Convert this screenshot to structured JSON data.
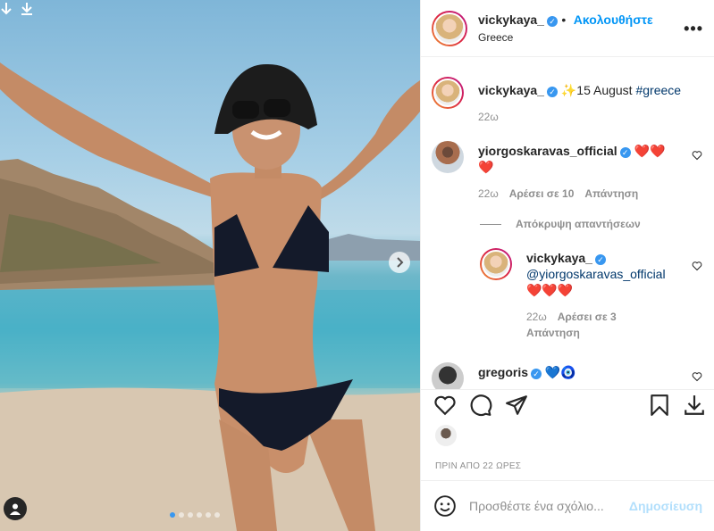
{
  "post": {
    "username": "vickykaya_",
    "follow_label": "Ακολουθήστε",
    "location": "Greece",
    "more_label": "•••"
  },
  "caption": {
    "username": "vickykaya_",
    "text_before": "✨15 August ",
    "hashtag": "#greece",
    "age": "22ω"
  },
  "comments": [
    {
      "username": "yiorgoskaravas_official",
      "text": "❤️❤️",
      "text_line2": "❤️",
      "age": "22ω",
      "likes": "Αρέσει σε 10",
      "reply": "Απάντηση"
    }
  ],
  "hide_replies": "Απόκρυψη απαντήσεων",
  "reply": {
    "username": "vickykaya_",
    "mention": "@yiorgoskaravas_official",
    "text": "❤️❤️❤️",
    "age": "22ω",
    "likes": "Αρέσει σε 3",
    "reply": "Απάντηση"
  },
  "partial_comment": {
    "username": "gregoris",
    "text": "💙🧿"
  },
  "timestamp": "ΠΡΙΝ ΑΠΟ 22 ΩΡΕΣ",
  "add_comment": {
    "placeholder": "Προσθέστε ένα σχόλιο...",
    "post_label": "Δημοσίευση"
  },
  "carousel": {
    "total": 6,
    "current": 1
  },
  "icons": {
    "download": "download-arrow-icon",
    "next": "chevron-right-icon",
    "tag": "user-tag-icon",
    "like": "heart-icon",
    "comment": "comment-bubble-icon",
    "share": "paper-plane-icon",
    "save": "bookmark-icon",
    "download_post": "download-icon",
    "emoji": "smiley-icon"
  },
  "colors": {
    "accent": "#0095f6",
    "verified": "#3897f0",
    "heart": "#ed4956"
  }
}
